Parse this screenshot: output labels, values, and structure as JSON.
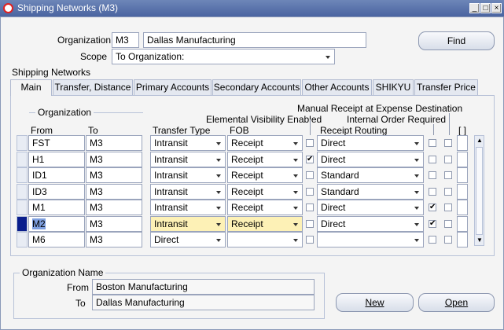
{
  "window": {
    "title": "Shipping Networks (M3)"
  },
  "header": {
    "organization_label": "Organization",
    "organization_code": "M3",
    "organization_name": "Dallas Manufacturing",
    "scope_label": "Scope",
    "scope_value": "To Organization:",
    "find_label": "Find"
  },
  "section_title": "Shipping Networks",
  "tabs": [
    "Main",
    "Transfer, Distance",
    "Primary Accounts",
    "Secondary Accounts",
    "Other Accounts",
    "SHIKYU",
    "Transfer Price"
  ],
  "columns": {
    "organization_group": "Organization",
    "from": "From",
    "to": "To",
    "transfer_type": "Transfer Type",
    "fob": "FOB",
    "elemental_visibility": "Elemental Visibility Enabled",
    "manual_receipt": "Manual Receipt at Expense Destination",
    "internal_order": "Internal Order Required",
    "receipt_routing": "Receipt Routing",
    "dff": "[ ]"
  },
  "rows": [
    {
      "from": "FST",
      "to": "M3",
      "transfer_type": "Intransit",
      "fob": "Receipt",
      "elemental": "",
      "routing": "Direct",
      "internal": "",
      "manual": ""
    },
    {
      "from": "H1",
      "to": "M3",
      "transfer_type": "Intransit",
      "fob": "Receipt",
      "elemental": "✔",
      "routing": "Direct",
      "internal": "",
      "manual": ""
    },
    {
      "from": "ID1",
      "to": "M3",
      "transfer_type": "Intransit",
      "fob": "Receipt",
      "elemental": "",
      "routing": "Standard",
      "internal": "",
      "manual": ""
    },
    {
      "from": "ID3",
      "to": "M3",
      "transfer_type": "Intransit",
      "fob": "Receipt",
      "elemental": "",
      "routing": "Standard",
      "internal": "",
      "manual": ""
    },
    {
      "from": "M1",
      "to": "M3",
      "transfer_type": "Intransit",
      "fob": "Receipt",
      "elemental": "",
      "routing": "Direct",
      "internal": "✔",
      "manual": ""
    },
    {
      "from": "M2",
      "to": "M3",
      "transfer_type": "Intransit",
      "fob": "Receipt",
      "elemental": "",
      "routing": "Direct",
      "internal": "✔",
      "manual": ""
    },
    {
      "from": "M6",
      "to": "M3",
      "transfer_type": "Direct",
      "fob": "",
      "elemental": "",
      "routing": "",
      "internal": "",
      "manual": ""
    }
  ],
  "org_name_panel": {
    "title": "Organization Name",
    "from_label": "From",
    "from_value": "Boston Manufacturing",
    "to_label": "To",
    "to_value": "Dallas Manufacturing"
  },
  "buttons": {
    "new": "New",
    "open": "Open"
  }
}
